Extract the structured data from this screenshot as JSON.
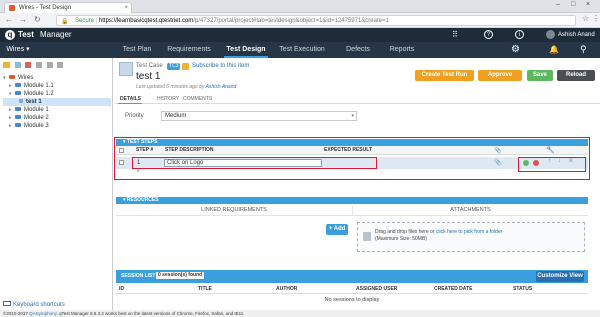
{
  "browser": {
    "tab_title": "Wires - Test Design",
    "tab_close": "×",
    "window_controls": [
      "–",
      "□",
      "×"
    ],
    "secure_label": "Secure",
    "url_domain": "https://learnbasicqtest.qtestnet.com",
    "url_path": "/p/47327/portal/project#tab=testdesign&object=1&id=12475971&create=1"
  },
  "app": {
    "logo_q": "q",
    "logo_text": "Test",
    "logo_manager": "Manager",
    "user_name": "Ashish Anand",
    "project": "Wires ▾",
    "menu": [
      "Test Plan",
      "Requirements",
      "Test Design",
      "Test Execution",
      "Defects",
      "Reports"
    ],
    "active_menu": "Test Design"
  },
  "tree": {
    "items": [
      {
        "label": "Wires",
        "level": 0,
        "type": "root"
      },
      {
        "label": "Module 1.1",
        "level": 1,
        "type": "folder"
      },
      {
        "label": "Module 1.2",
        "level": 1,
        "type": "folder"
      },
      {
        "label": "test 1",
        "level": 2,
        "type": "test"
      },
      {
        "label": "Module 1",
        "level": 1,
        "type": "folder"
      },
      {
        "label": "Module 2",
        "level": 1,
        "type": "folder"
      },
      {
        "label": "Module 3",
        "level": 1,
        "type": "folder"
      }
    ],
    "keyboard_shortcuts": "Keyboard shortcuts"
  },
  "testcase": {
    "label": "Test Case",
    "id_badge": "TC3",
    "subscribe": "Subscribe to this item",
    "name": "test 1",
    "updated_prefix": "Last updated 6 minutes ago by",
    "updated_by": "Ashish Anand",
    "tabs": [
      "DETAILS",
      "HISTORY",
      "COMMENTS"
    ],
    "priority_label": "Priority",
    "priority_value": "Medium"
  },
  "buttons": {
    "create_test_run": "Create Test Run",
    "approve": "Approve",
    "save": "Save",
    "reload": "Reload",
    "add": "+ Add",
    "customize_view": "Customize View"
  },
  "test_steps": {
    "header": "▾ TEST STEPS",
    "col_step": "STEP #",
    "col_desc": "STEP DESCRIPTION",
    "col_expected": "EXPECTED RESULT",
    "row_num": "1",
    "row_desc": "Click on Logo",
    "new_row_mark": "*"
  },
  "resources": {
    "header": "▾ RESOURCES",
    "linked": "LINKED REQUIREMENTS",
    "attachments": "ATTACHMENTS",
    "drop_text": "Drag and drop files here or",
    "drop_link": "click here to pick from a folder",
    "drop_max": "(Maximum Size: 50MB)"
  },
  "session": {
    "header_label": "SESSION LIST",
    "header_count": "0 session(s) found",
    "cols": [
      "ID",
      "TITLE",
      "AUTHOR",
      "ASSIGNED USER",
      "CREATED DATE",
      "STATUS"
    ],
    "empty": "No sessions to display"
  },
  "footer": {
    "text": "©2010-2017",
    "link": "QASymphony",
    "rest": ". qTest Manager 8.5.3.2 works best on the latest versions of Chrome, Firefox, Safari, and IE11."
  },
  "colors": {
    "header_dark": "#1e2b38",
    "accent_blue": "#3aa0dd",
    "approve_orange": "#f0a020",
    "save_green": "#5cb85c",
    "highlight_red": "#e0182f"
  }
}
